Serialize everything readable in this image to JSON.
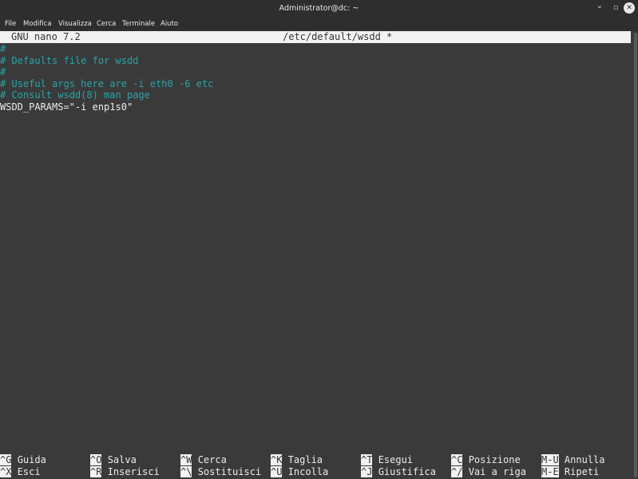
{
  "window": {
    "title": "Administrator@dc: ~",
    "minimize_glyph": "⌄",
    "maximize_glyph": "▫",
    "close_glyph": "✕"
  },
  "menu": [
    "File",
    "Modifica",
    "Visualizza",
    "Cerca",
    "Terminale",
    "Aiuto"
  ],
  "nano": {
    "version": "GNU nano 7.2",
    "file": "/etc/default/wsdd *"
  },
  "content": [
    {
      "text": "#",
      "kind": "comment"
    },
    {
      "text": "# Defaults file for wsdd",
      "kind": "comment"
    },
    {
      "text": "#",
      "kind": "comment"
    },
    {
      "text": "# Useful args here are -i eth0 -6 etc",
      "kind": "comment"
    },
    {
      "text": "# Consult wsdd(8) man page",
      "kind": "comment"
    },
    {
      "text": "WSDD_PARAMS=\"-i enp1s0\"",
      "kind": "code"
    }
  ],
  "shortcuts": {
    "row1": [
      {
        "key": "^G",
        "label": "Guida"
      },
      {
        "key": "^O",
        "label": "Salva"
      },
      {
        "key": "^W",
        "label": "Cerca"
      },
      {
        "key": "^K",
        "label": "Taglia"
      },
      {
        "key": "^T",
        "label": "Esegui"
      },
      {
        "key": "^C",
        "label": "Posizione"
      },
      {
        "key": "M-U",
        "label": "Annulla"
      }
    ],
    "row2": [
      {
        "key": "^X",
        "label": "Esci"
      },
      {
        "key": "^R",
        "label": "Inserisci"
      },
      {
        "key": "^\\",
        "label": "Sostituisci"
      },
      {
        "key": "^U",
        "label": "Incolla"
      },
      {
        "key": "^J",
        "label": "Giustifica"
      },
      {
        "key": "^/",
        "label": "Vai a riga"
      },
      {
        "key": "M-E",
        "label": "Ripeti"
      }
    ]
  },
  "colors": {
    "comment": "#26a6a6",
    "text": "#ececec",
    "background": "#3a3a3a",
    "inverse_bg": "#f2f2f2"
  }
}
